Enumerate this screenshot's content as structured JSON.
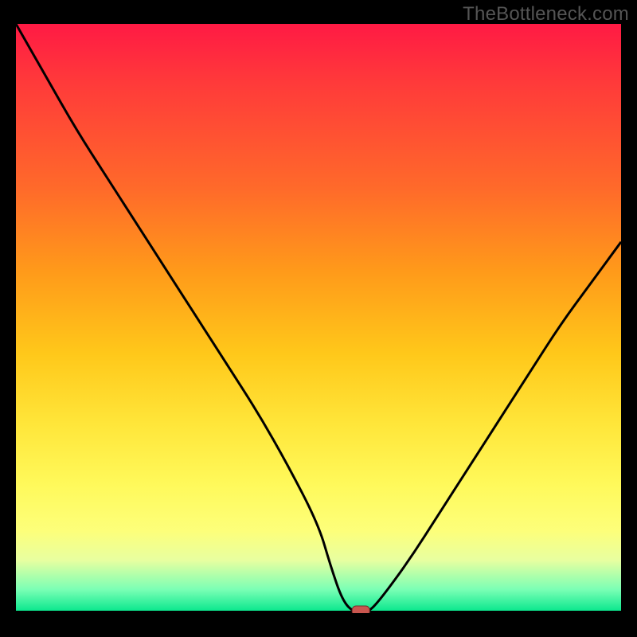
{
  "watermark": "TheBottleneck.com",
  "chart_data": {
    "type": "line",
    "title": "",
    "xlabel": "",
    "ylabel": "",
    "xlim": [
      0,
      100
    ],
    "ylim": [
      0,
      100
    ],
    "x": [
      0,
      5,
      10,
      15,
      20,
      25,
      30,
      35,
      40,
      45,
      50,
      52,
      54,
      56,
      58,
      60,
      65,
      70,
      75,
      80,
      85,
      90,
      95,
      100
    ],
    "values": [
      100,
      91,
      82,
      74,
      66,
      58,
      50,
      42,
      34,
      25,
      15,
      8,
      2,
      0,
      0,
      2,
      9,
      17,
      25,
      33,
      41,
      49,
      56,
      63
    ],
    "marker": {
      "x": 57,
      "y": 0
    },
    "gradient_stops": [
      {
        "pos": 0,
        "color": "#ff1a44"
      },
      {
        "pos": 10,
        "color": "#ff3a3a"
      },
      {
        "pos": 28,
        "color": "#ff6a2a"
      },
      {
        "pos": 42,
        "color": "#ff9a1a"
      },
      {
        "pos": 56,
        "color": "#ffc81a"
      },
      {
        "pos": 68,
        "color": "#ffe63a"
      },
      {
        "pos": 78,
        "color": "#fff95a"
      },
      {
        "pos": 86,
        "color": "#fdff7a"
      },
      {
        "pos": 91,
        "color": "#e8ffa0"
      },
      {
        "pos": 96,
        "color": "#7affb5"
      },
      {
        "pos": 100,
        "color": "#00e58a"
      }
    ]
  }
}
